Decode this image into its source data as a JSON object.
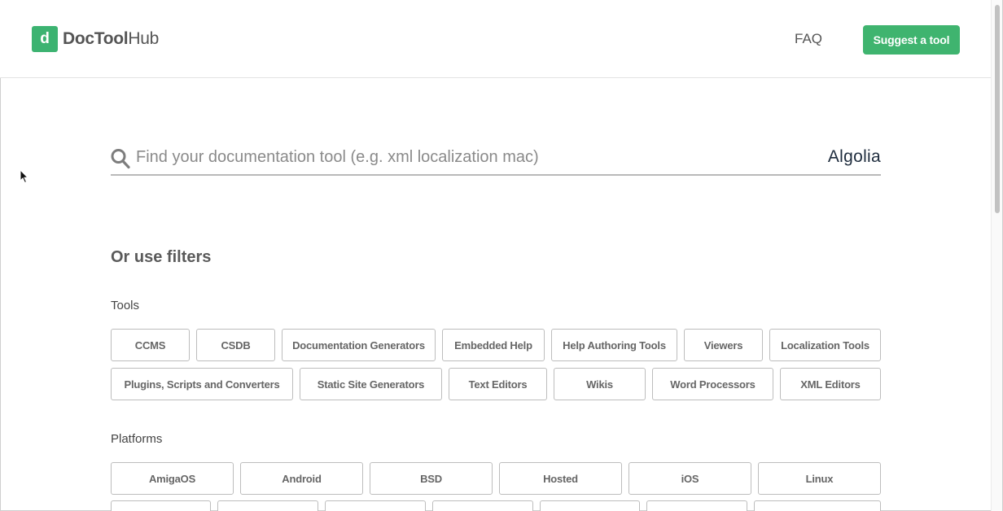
{
  "brand": {
    "mark": "d",
    "name_bold": "DocTool",
    "name_regular": "Hub"
  },
  "nav": {
    "faq": "FAQ",
    "suggest": "Suggest a tool"
  },
  "search": {
    "placeholder": "Find your documentation tool (e.g. xml localization mac)",
    "value": "",
    "provider": "Algolia"
  },
  "filters": {
    "title": "Or use filters",
    "tools_label": "Tools",
    "tools": [
      "CCMS",
      "CSDB",
      "Documentation Generators",
      "Embedded Help",
      "Help Authoring Tools",
      "Viewers",
      "Localization Tools",
      "Plugins, Scripts and Converters",
      "Static Site Generators",
      "Text Editors",
      "Wikis",
      "Word Processors",
      "XML Editors"
    ],
    "platforms_label": "Platforms",
    "platforms": [
      "AmigaOS",
      "Android",
      "BSD",
      "Hosted",
      "iOS",
      "Linux"
    ]
  },
  "colors": {
    "brand_green": "#3fb46f",
    "algolia_blue": "#3aa6da"
  }
}
